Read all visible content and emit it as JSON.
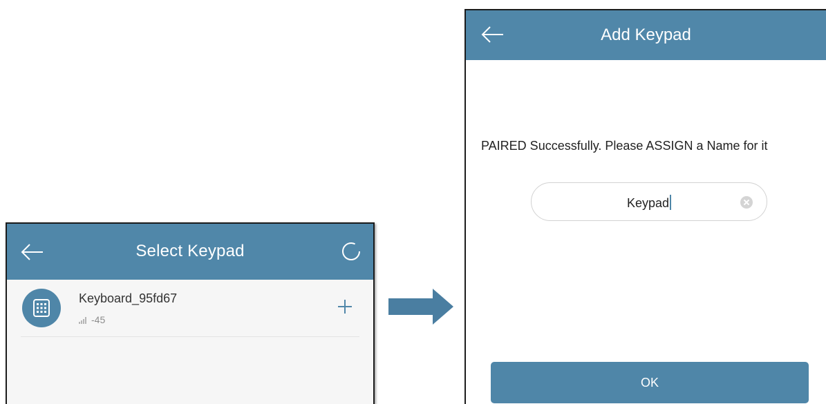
{
  "colors": {
    "accent": "#5087a9",
    "button": "#4f86a8",
    "list_background": "#f6f6f6",
    "text": "#333333",
    "muted_text": "#8c8c8c"
  },
  "select_screen": {
    "title": "Select Keypad",
    "back_icon": "arrow-left-icon",
    "loading_icon": "spinner-icon",
    "devices": [
      {
        "name": "Keyboard_95fd67",
        "signal": "-45",
        "icon": "keypad-icon",
        "action_icon": "plus-icon"
      }
    ]
  },
  "transition_icon": "arrow-right-icon",
  "add_screen": {
    "title": "Add Keypad",
    "back_icon": "arrow-left-icon",
    "message": "PAIRED Successfully. Please ASSIGN a Name for it",
    "name_input": {
      "value": "Keypad",
      "clear_icon": "clear-icon"
    },
    "ok_label": "OK"
  }
}
